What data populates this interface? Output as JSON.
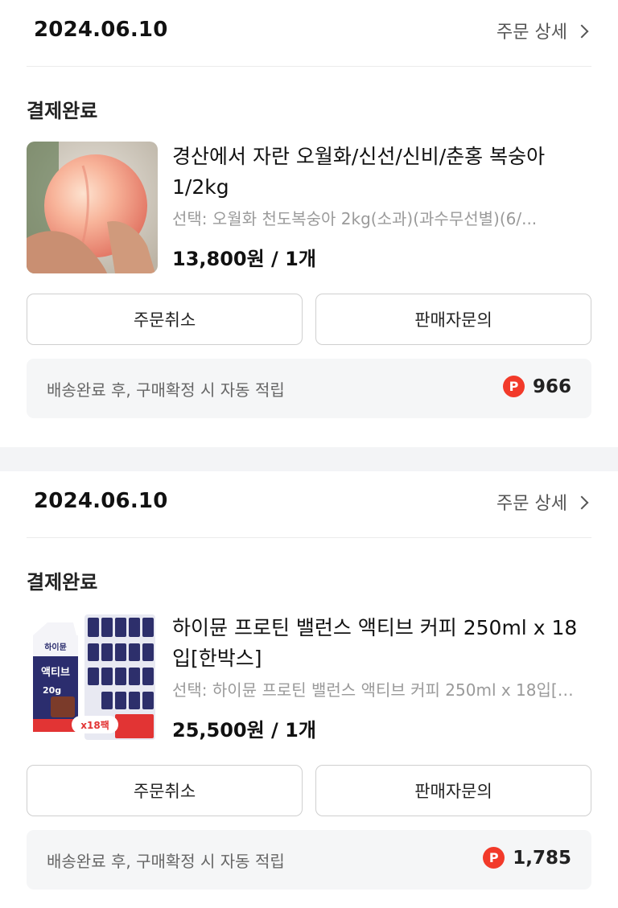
{
  "orders": [
    {
      "date": "2024.06.10",
      "detail_label": "주문 상세",
      "status": "결제완료",
      "product": {
        "title": "경산에서 자란 오월화/신선/신비/춘홍 복숭아 1/2kg",
        "option": "선택: 오월화 천도복숭아 2kg(소과)(과수무선별)(6/...",
        "price": "13,800원 / 1개",
        "image_icon": "peach-product-image"
      },
      "buttons": {
        "cancel": "주문취소",
        "inquiry": "판매자문의"
      },
      "reward": {
        "text": "배송완료 후, 구매확정 시 자동 적립",
        "badge": "P",
        "points": "966"
      }
    },
    {
      "date": "2024.06.10",
      "detail_label": "주문 상세",
      "status": "결제완료",
      "product": {
        "title": "하이뮨 프로틴 밸런스 액티브 커피 250ml x 18입[한박스]",
        "option": "선택: 하이뮨 프로틴 밸런스 액티브 커피 250ml x 18입[한박스]",
        "price": "25,500원 / 1개",
        "image_icon": "protein-drink-product-image",
        "image_text": {
          "brand": "하이뮨",
          "name": "액티브",
          "tag": "20g",
          "count": "x18팩"
        }
      },
      "buttons": {
        "cancel": "주문취소",
        "inquiry": "판매자문의"
      },
      "reward": {
        "text": "배송완료 후, 구매확정 시 자동 적립",
        "badge": "P",
        "points": "1,785"
      }
    }
  ],
  "colors": {
    "point_badge": "#f23a2a",
    "separator": "#f3f4f6",
    "reward_bg": "#f5f6f7"
  }
}
